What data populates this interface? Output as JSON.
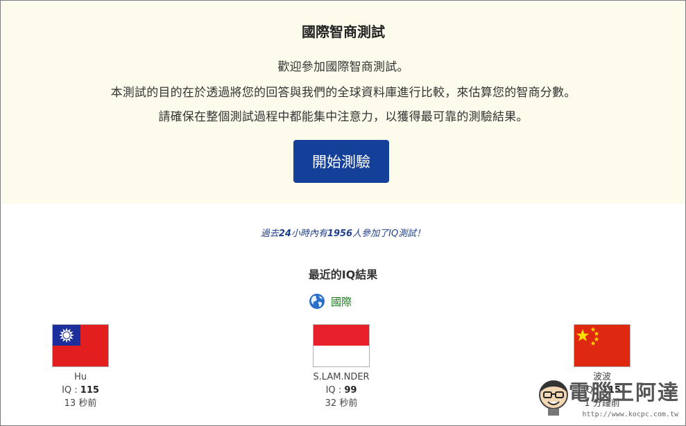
{
  "intro": {
    "title": "國際智商測試",
    "line1": "歡迎參加國際智商測試。",
    "line2": "本測試的目的在於透過將您的回答與我們的全球資料庫進行比較，來估算您的智商分數。",
    "line3": "請確保在整個測試過程中都能集中注意力，以獲得最可靠的測驗結果。",
    "start_button": "開始測驗"
  },
  "stats": {
    "prefix": "過去",
    "hours": "24",
    "mid": "小時內有",
    "count": "1956",
    "suffix": "人參加了IQ測試！"
  },
  "recent": {
    "title": "最近的IQ結果",
    "region_label": "國際",
    "iq_label": "IQ",
    "results": [
      {
        "name": "Hu",
        "iq": "115",
        "ago": "13 秒前",
        "flag": "taiwan-flag-icon"
      },
      {
        "name": "S.LAM.NDER",
        "iq": "99",
        "ago": "32 秒前",
        "flag": "indonesia-flag-icon"
      },
      {
        "name": "波波",
        "iq": "115",
        "ago": "1 分鐘前",
        "flag": "china-flag-icon"
      }
    ]
  },
  "watermark": {
    "text": "電腦王阿達",
    "url": "http://www.kocpc.com.tw"
  },
  "colors": {
    "intro_bg": "#fdfbec",
    "button_bg": "#15409a",
    "stat_text": "#1f3f8a",
    "region_text": "#1c7a1c"
  }
}
